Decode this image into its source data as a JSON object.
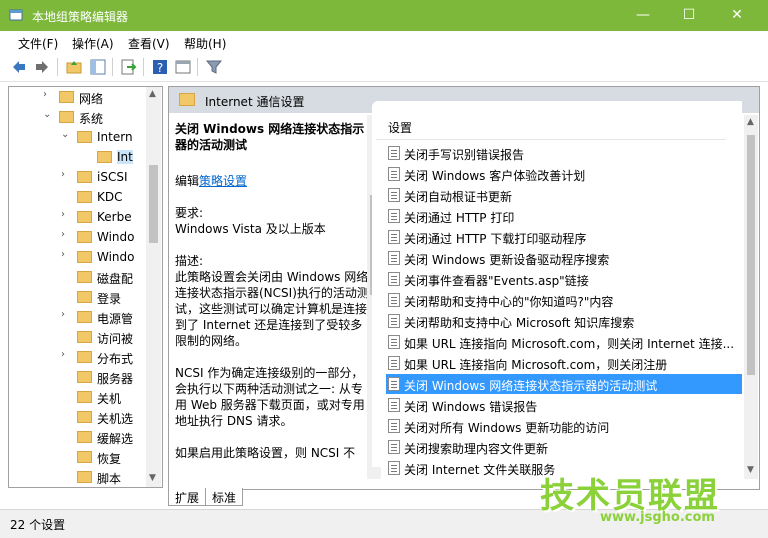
{
  "window": {
    "title": "本地组策略编辑器",
    "min": "—",
    "max": "☐",
    "close": "✕"
  },
  "menu": [
    "文件(F)",
    "操作(A)",
    "查看(V)",
    "帮助(H)"
  ],
  "tree": {
    "items": [
      {
        "label": "网络",
        "level": 2,
        "expander": "›"
      },
      {
        "label": "系统",
        "level": 2,
        "expander": "⌄"
      },
      {
        "label": "Intern",
        "level": 3,
        "expander": "⌄"
      },
      {
        "label": "Int",
        "level": 4,
        "expander": "",
        "selected": true
      },
      {
        "label": "iSCSI",
        "level": 3,
        "expander": "›"
      },
      {
        "label": "KDC",
        "level": 3,
        "expander": ""
      },
      {
        "label": "Kerbe",
        "level": 3,
        "expander": "›"
      },
      {
        "label": "Windo",
        "level": 3,
        "expander": "›"
      },
      {
        "label": "Windo",
        "level": 3,
        "expander": "›"
      },
      {
        "label": "磁盘配",
        "level": 3,
        "expander": ""
      },
      {
        "label": "登录",
        "level": 3,
        "expander": ""
      },
      {
        "label": "电源管",
        "level": 3,
        "expander": "›"
      },
      {
        "label": "访问被",
        "level": 3,
        "expander": ""
      },
      {
        "label": "分布式",
        "level": 3,
        "expander": "›"
      },
      {
        "label": "服务器",
        "level": 3,
        "expander": ""
      },
      {
        "label": "关机",
        "level": 3,
        "expander": ""
      },
      {
        "label": "关机选",
        "level": 3,
        "expander": ""
      },
      {
        "label": "缓解选",
        "level": 3,
        "expander": ""
      },
      {
        "label": "恢复",
        "level": 3,
        "expander": ""
      },
      {
        "label": "脚本",
        "level": 3,
        "expander": ""
      }
    ]
  },
  "panel": {
    "header": "Internet 通信设置",
    "desc": {
      "heading": "关闭 Windows 网络连接状态指示器的活动测试",
      "edit_prefix": "编辑",
      "edit_link": "策略设置",
      "req_label": "要求:",
      "req_value": "Windows Vista 及以上版本",
      "desc_label": "描述:",
      "desc_text": "此策略设置会关闭由 Windows 网络连接状态指示器(NCSI)执行的活动测试，这些测试可以确定计算机是连接到了 Internet 还是连接到了受较多限制的网络。",
      "ncsi_text": "NCSI 作为确定连接级别的一部分，会执行以下两种活动测试之一: 从专用 Web 服务器下载页面，或对专用地址执行 DNS 请求。",
      "cut_text": "如果启用此策略设置，则 NCSI 不"
    },
    "list_header": "设置",
    "settings": [
      "关闭手写识别错误报告",
      "关闭 Windows 客户体验改善计划",
      "关闭自动根证书更新",
      "关闭通过 HTTP 打印",
      "关闭通过 HTTP 下载打印驱动程序",
      "关闭 Windows 更新设备驱动程序搜索",
      "关闭事件查看器\"Events.asp\"链接",
      "关闭帮助和支持中心的\"你知道吗?\"内容",
      "关闭帮助和支持中心 Microsoft 知识库搜索",
      "如果 URL 连接指向 Microsoft.com，则关闭 Internet 连接...",
      "如果 URL 连接指向 Microsoft.com，则关闭注册",
      "关闭 Windows 网络连接状态指示器的活动测试",
      "关闭 Windows 错误报告",
      "关闭对所有 Windows 更新功能的访问",
      "关闭搜索助理内容文件更新",
      "关闭 Internet 文件关联服务"
    ],
    "selected_index": 11
  },
  "tabs": [
    "扩展",
    "标准"
  ],
  "status": "22 个设置",
  "watermark": {
    "big": "技术员联盟",
    "small": "www.jsgho.com"
  },
  "colors": {
    "titlebar": "#7db83b",
    "selection": "#3399ff",
    "watermark": "#8bd13a"
  }
}
